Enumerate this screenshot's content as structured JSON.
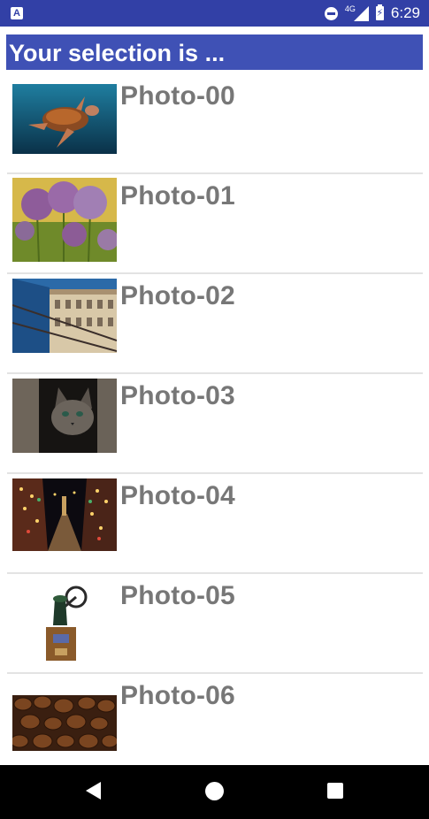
{
  "status_bar": {
    "time": "6:29",
    "network": "4G",
    "icons": [
      "app-notification-icon",
      "do-not-disturb-icon",
      "signal-icon",
      "battery-charging-icon"
    ]
  },
  "header": {
    "title": "Your selection is ..."
  },
  "photos": [
    {
      "label": "Photo-00",
      "image": "turtle-image"
    },
    {
      "label": "Photo-01",
      "image": "flowers-image"
    },
    {
      "label": "Photo-02",
      "image": "building-image"
    },
    {
      "label": "Photo-03",
      "image": "kitten-image"
    },
    {
      "label": "Photo-04",
      "image": "night-street-image"
    },
    {
      "label": "Photo-05",
      "image": "coffee-grinder-image"
    },
    {
      "label": "Photo-06",
      "image": "coffee-beans-image"
    }
  ],
  "nav": {
    "icons": [
      "back-icon",
      "home-icon",
      "recents-icon"
    ]
  },
  "colors": {
    "status_bar": "#3240a6",
    "header": "#3f51b5",
    "label": "#777777"
  }
}
